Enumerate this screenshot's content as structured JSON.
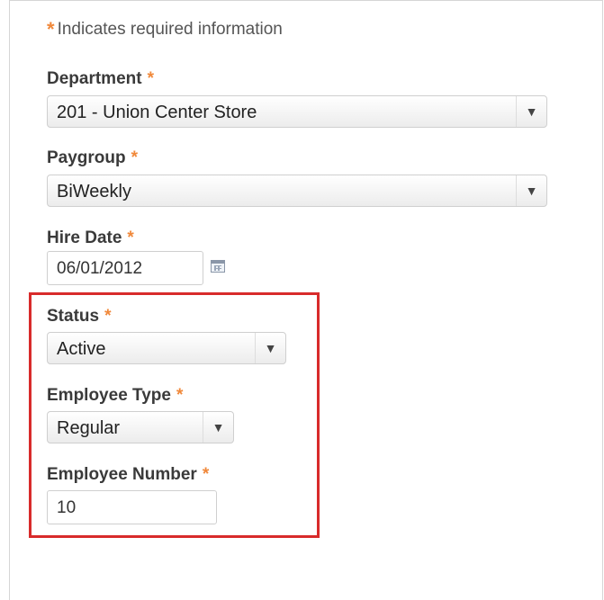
{
  "required_note": {
    "star": "*",
    "text": "Indicates required information"
  },
  "department": {
    "label": "Department",
    "star": "*",
    "value": "201 - Union Center Store"
  },
  "paygroup": {
    "label": "Paygroup",
    "star": "*",
    "value": "BiWeekly"
  },
  "hire_date": {
    "label": "Hire Date",
    "star": "*",
    "value": "06/01/2012"
  },
  "status": {
    "label": "Status",
    "star": "*",
    "value": "Active"
  },
  "employee_type": {
    "label": "Employee Type",
    "star": "*",
    "value": "Regular"
  },
  "employee_number": {
    "label": "Employee Number",
    "star": "*",
    "value": "10"
  },
  "icons": {
    "dropdown": "chevron-down-icon",
    "calendar": "calendar-icon"
  },
  "colors": {
    "required_star": "#f0883a",
    "highlight_border": "#d82b2b"
  }
}
